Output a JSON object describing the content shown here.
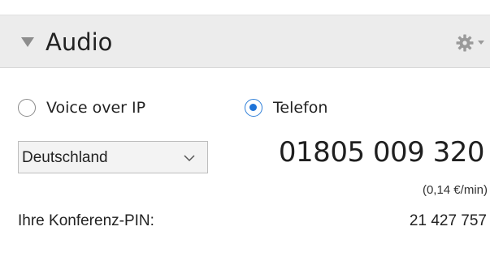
{
  "panel": {
    "title": "Audio",
    "collapse_icon": "triangle-down-icon",
    "settings_icon": "gear-icon"
  },
  "audio_options": {
    "voip_label": "Voice over IP",
    "voip_checked": false,
    "telefon_label": "Telefon",
    "telefon_checked": true
  },
  "country": {
    "selected": "Deutschland"
  },
  "phone": {
    "number": "01805 009 320",
    "price_note": "(0,14 €/min)"
  },
  "pin": {
    "label": "Ihre Konferenz-PIN:",
    "value": "21 427 757"
  },
  "colors": {
    "header_bg": "#ececec",
    "radio_selected": "#1e73d8"
  }
}
